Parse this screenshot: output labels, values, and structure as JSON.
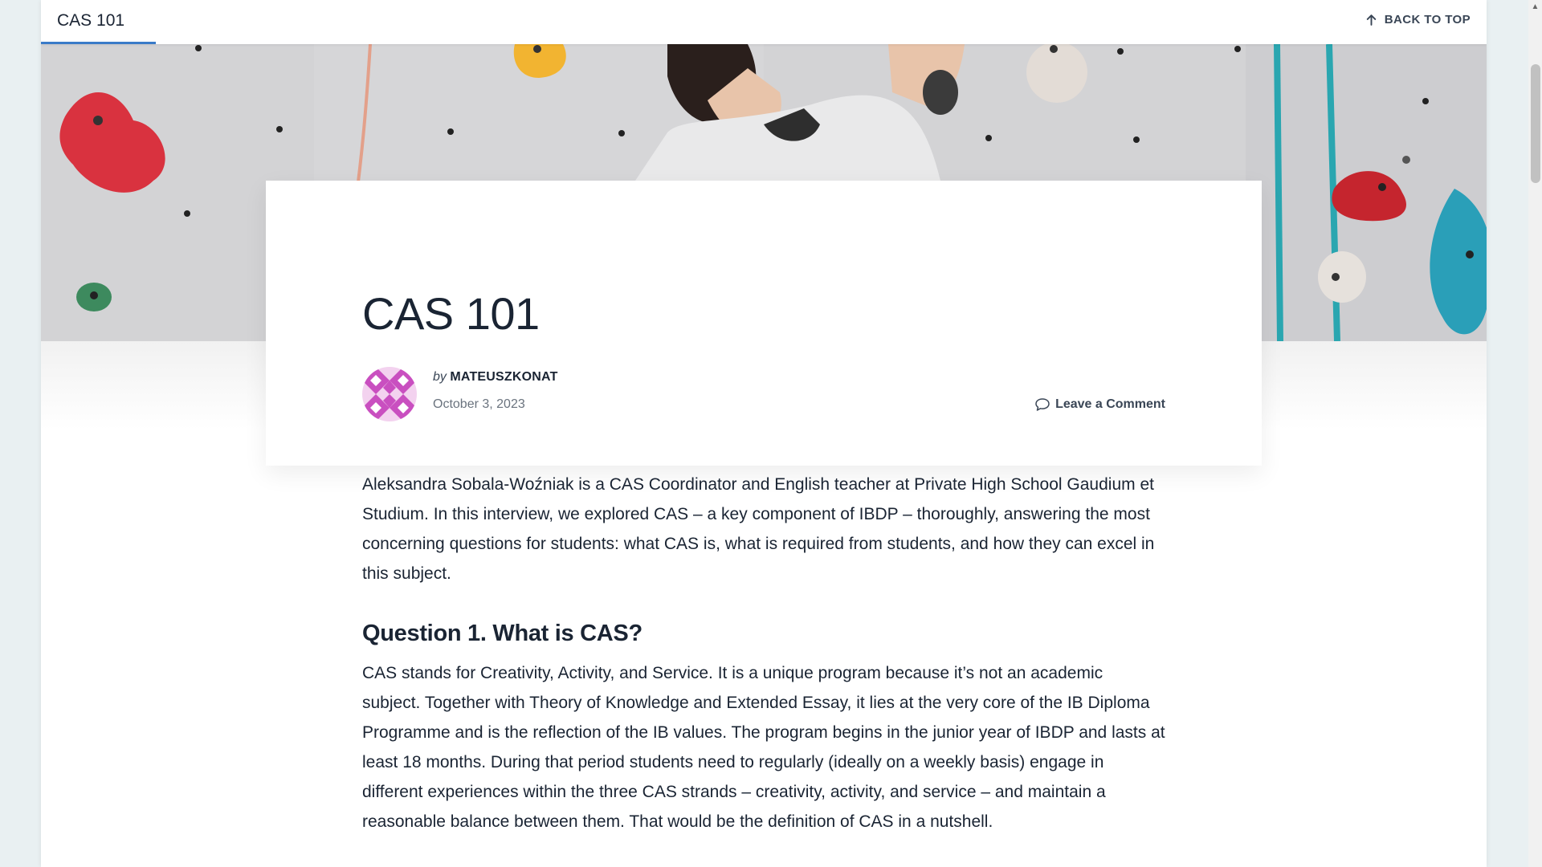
{
  "topbar": {
    "title": "CAS 101",
    "back_to_top": "BACK TO TOP"
  },
  "post": {
    "title": "CAS 101",
    "by_label": "by",
    "author": "MATEUSZKONAT",
    "date": "October 3, 2023",
    "comment_link": "Leave a Comment"
  },
  "article": {
    "intro": "Aleksandra Sobala-Woźniak is a CAS Coordinator and English teacher at Private High School Gaudium et Studium. In this interview, we explored CAS – a key component of IBDP – thoroughly, answering the most concerning questions for students: what CAS is, what is required from students, and how they can excel in this subject.",
    "q1_heading": "Question 1. What is CAS?",
    "q1_answer": "CAS stands for Creativity, Activity, and Service. It is a unique program because it’s not an academic subject. Together with Theory of Knowledge and Extended Essay, it lies at the very core of the IB Diploma Programme and is the reflection of the IB values. The program begins in the junior year of IBDP and lasts at least 18 months. During that period students need to regularly (ideally on a weekly basis) engage in different experiences within the three CAS strands – creativity, activity, and service – and maintain a reasonable balance between them. That would be the definition of CAS in a nutshell."
  },
  "colors": {
    "text": "#1a2433",
    "accent": "#3a7bc8",
    "avatar": "#c94fc0",
    "wall": "#d4d4d6"
  },
  "icons": {
    "back_to_top": "arrow-up-icon",
    "comment": "comment-bubble-icon",
    "avatar": "identicon"
  }
}
